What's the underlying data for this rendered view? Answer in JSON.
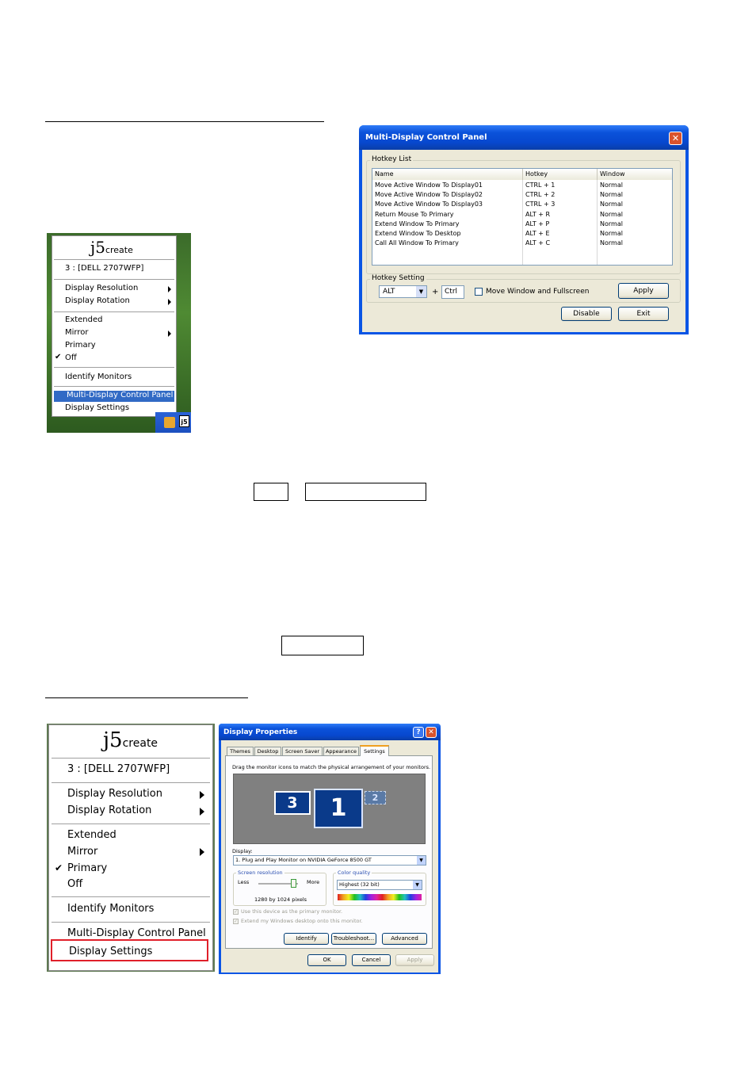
{
  "menu1": {
    "logo_j5": "j5",
    "logo_create": "create",
    "items": [
      {
        "label": "3 : [DELL 2707WFP]"
      },
      {
        "label": "Display Resolution"
      },
      {
        "label": "Display Rotation"
      },
      {
        "label": "Extended"
      },
      {
        "label": "Mirror"
      },
      {
        "label": "Primary"
      },
      {
        "label": "Off"
      },
      {
        "label": "Identify Monitors"
      },
      {
        "label": "Multi-Display Control Panel"
      },
      {
        "label": "Display Settings"
      }
    ],
    "checked_item": "Off",
    "highlighted_item": "Multi-Display Control Panel",
    "tray_icon_label": "j5"
  },
  "control_panel": {
    "title": "Multi-Display Control Panel",
    "hotkey_list_label": "Hotkey List",
    "columns": [
      "Name",
      "Hotkey",
      "Window"
    ],
    "rows": [
      [
        "Move Active Window To Display01",
        "CTRL + 1",
        "Normal"
      ],
      [
        "Move Active Window To Display02",
        "CTRL + 2",
        "Normal"
      ],
      [
        "Move Active Window To Display03",
        "CTRL + 3",
        "Normal"
      ],
      [
        "Return Mouse To Primary",
        "ALT + R",
        "Normal"
      ],
      [
        "Extend Window To Primary",
        "ALT + P",
        "Normal"
      ],
      [
        "Extend Window To Desktop",
        "ALT + E",
        "Normal"
      ],
      [
        "Call All Window To Primary",
        "ALT + C",
        "Normal"
      ]
    ],
    "hotkey_setting_label": "Hotkey Setting",
    "modifier_value": "ALT",
    "plus": "+",
    "key_value": "Ctrl",
    "checkbox_label": "Move Window and Fullscreen",
    "apply_label": "Apply",
    "disable_label": "Disable",
    "exit_label": "Exit"
  },
  "menu2": {
    "logo_j5": "j5",
    "logo_create": "create",
    "items": [
      {
        "label": "3 : [DELL 2707WFP]"
      },
      {
        "label": "Display Resolution"
      },
      {
        "label": "Display Rotation"
      },
      {
        "label": "Extended"
      },
      {
        "label": "Mirror"
      },
      {
        "label": "Primary"
      },
      {
        "label": "Off"
      },
      {
        "label": "Identify Monitors"
      },
      {
        "label": "Multi-Display Control Panel"
      },
      {
        "label": "Display Settings"
      }
    ],
    "checked_item": "Primary",
    "highlighted_item": "Display Settings"
  },
  "display_properties": {
    "title": "Display Properties",
    "help_glyph": "?",
    "tabs": [
      "Themes",
      "Desktop",
      "Screen Saver",
      "Appearance",
      "Settings"
    ],
    "active_tab": "Settings",
    "instruction": "Drag the monitor icons to match the physical arrangement of your monitors.",
    "monitors": [
      "3",
      "1",
      "2"
    ],
    "display_label": "Display:",
    "display_value": "1. Plug and Play Monitor on NVIDIA GeForce 8500 GT",
    "screen_resolution_label": "Screen resolution",
    "less_label": "Less",
    "more_label": "More",
    "resolution_value": "1280 by 1024 pixels",
    "color_quality_label": "Color quality",
    "color_quality_value": "Highest (32 bit)",
    "checkbox1_label": "Use this device as the primary monitor.",
    "checkbox2_label": "Extend my Windows desktop onto this monitor.",
    "identify_label": "Identify",
    "troubleshoot_label": "Troubleshoot...",
    "advanced_label": "Advanced",
    "ok_label": "OK",
    "cancel_label": "Cancel",
    "apply_label": "Apply"
  }
}
